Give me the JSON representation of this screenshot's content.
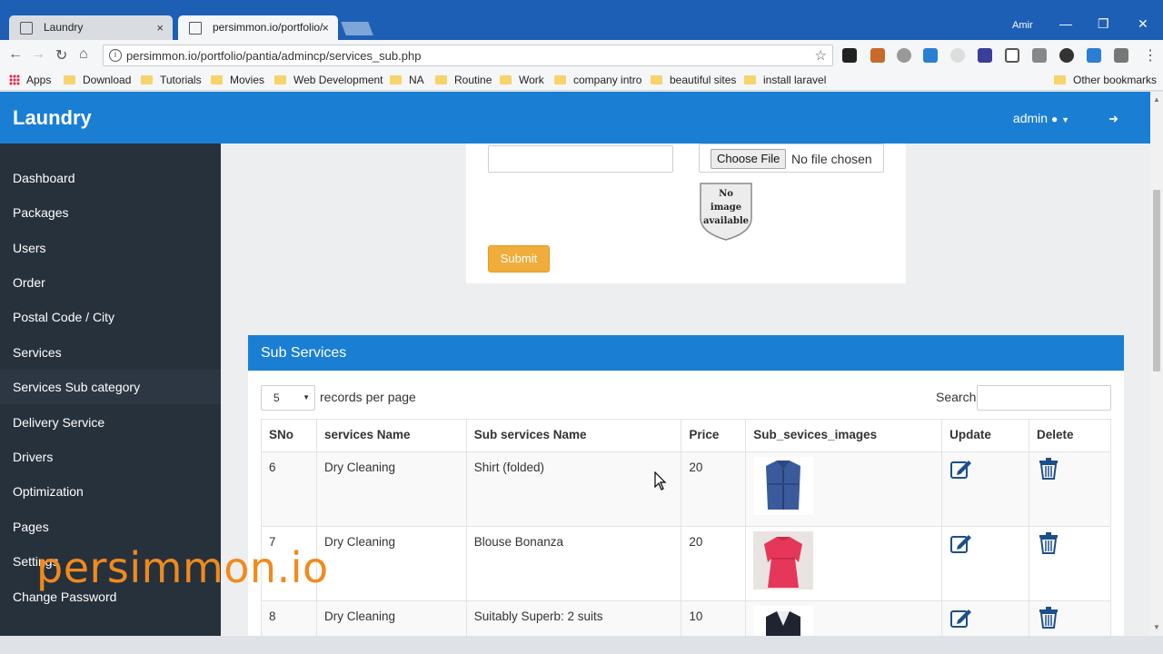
{
  "browser": {
    "tabs": [
      {
        "title": "Laundry",
        "close": "×"
      },
      {
        "title": "persimmon.io/portfolio/",
        "close": "×"
      }
    ],
    "user": "Amir",
    "window_controls": [
      "—",
      "❐",
      "✕"
    ],
    "url": "persimmon.io/portfolio/pantia/admincp/services_sub.php",
    "bookmarks": [
      "Apps",
      "Download",
      "Tutorials",
      "Movies",
      "Web Development",
      "NA",
      "Routine",
      "Work",
      "company intro",
      "beautiful sites",
      "install laravel"
    ],
    "other_bookmarks": "Other bookmarks"
  },
  "app": {
    "brand": "Laundry",
    "admin_label": "admin",
    "sidebar": [
      "Dashboard",
      "Packages",
      "Users",
      "Order",
      "Postal Code / City",
      "Services",
      "Services Sub category",
      "Delivery Service",
      "Drivers",
      "Optimization",
      "Pages",
      "Settings",
      "Change Password"
    ],
    "form": {
      "choose_file": "Choose File",
      "file_status": "No file chosen",
      "no_image_lines": [
        "No",
        "image",
        "available"
      ],
      "submit": "Submit"
    },
    "panel": {
      "title": "Sub Services",
      "per_page_value": "5",
      "per_page_label": "records per page",
      "search_label": "Search:",
      "headers": [
        "SNo",
        "services Name",
        "Sub services Name",
        "Price",
        "Sub_sevices_images",
        "Update",
        "Delete"
      ],
      "rows": [
        {
          "sno": "6",
          "service": "Dry Cleaning",
          "sub": "Shirt (folded)",
          "price": "20",
          "image": "shirt"
        },
        {
          "sno": "7",
          "service": "Dry Cleaning",
          "sub": "Blouse Bonanza",
          "price": "20",
          "image": "blouse"
        },
        {
          "sno": "8",
          "service": "Dry Cleaning",
          "sub": "Suitably Superb: 2 suits",
          "price": "10",
          "image": "suit"
        }
      ]
    }
  },
  "watermark": "persimmon.io",
  "colors": {
    "primary": "#1a7fd3",
    "sidebar": "#27313c",
    "submit": "#f0ad3b",
    "watermark": "#f08a1c"
  }
}
